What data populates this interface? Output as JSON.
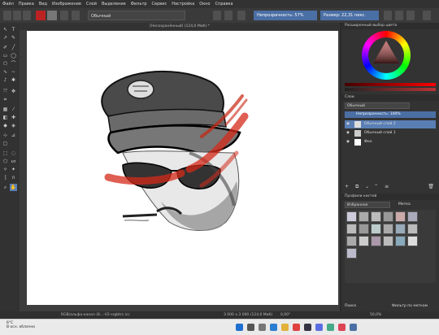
{
  "menu": [
    "Файл",
    "Правка",
    "Вид",
    "Изображение",
    "Слой",
    "Выделение",
    "Фильтр",
    "Сервис",
    "Настройка",
    "Окно",
    "Справка"
  ],
  "toolbar": {
    "blend_mode": "Обычный",
    "opacity_label": "Непрозрачность: 57%",
    "size_label": "Размер: 22,31 пикс."
  },
  "canvas": {
    "title": "[Несохранённый] (124,0 Миб) *"
  },
  "color_panel": {
    "title": "Расширенный выбор цвета"
  },
  "layers_panel": {
    "title": "Слои",
    "blend_mode": "Обычный",
    "opacity": "Непрозрачность: 100%",
    "layers": [
      {
        "name": "Обычный слой 2",
        "active": true
      },
      {
        "name": "Обычный слой 1",
        "active": false
      },
      {
        "name": "Фон",
        "active": false
      }
    ]
  },
  "brushes_panel": {
    "title": "Профили кистей",
    "filter": "Избранное",
    "tag_label": "Метка",
    "search_label": "Поиск",
    "checkbox_label": "Фильтр по меткам"
  },
  "status": {
    "color_profile": "RGB/альфа-канал (8...-V2-srgbtrc.icc",
    "dimensions": "3 000 x 3 000 (124,0 Миб)",
    "rotation": "0,00°",
    "zoom": "50,0%"
  },
  "taskbar": {
    "weather_temp": "6°C",
    "weather_desc": "В осн. облачно"
  }
}
